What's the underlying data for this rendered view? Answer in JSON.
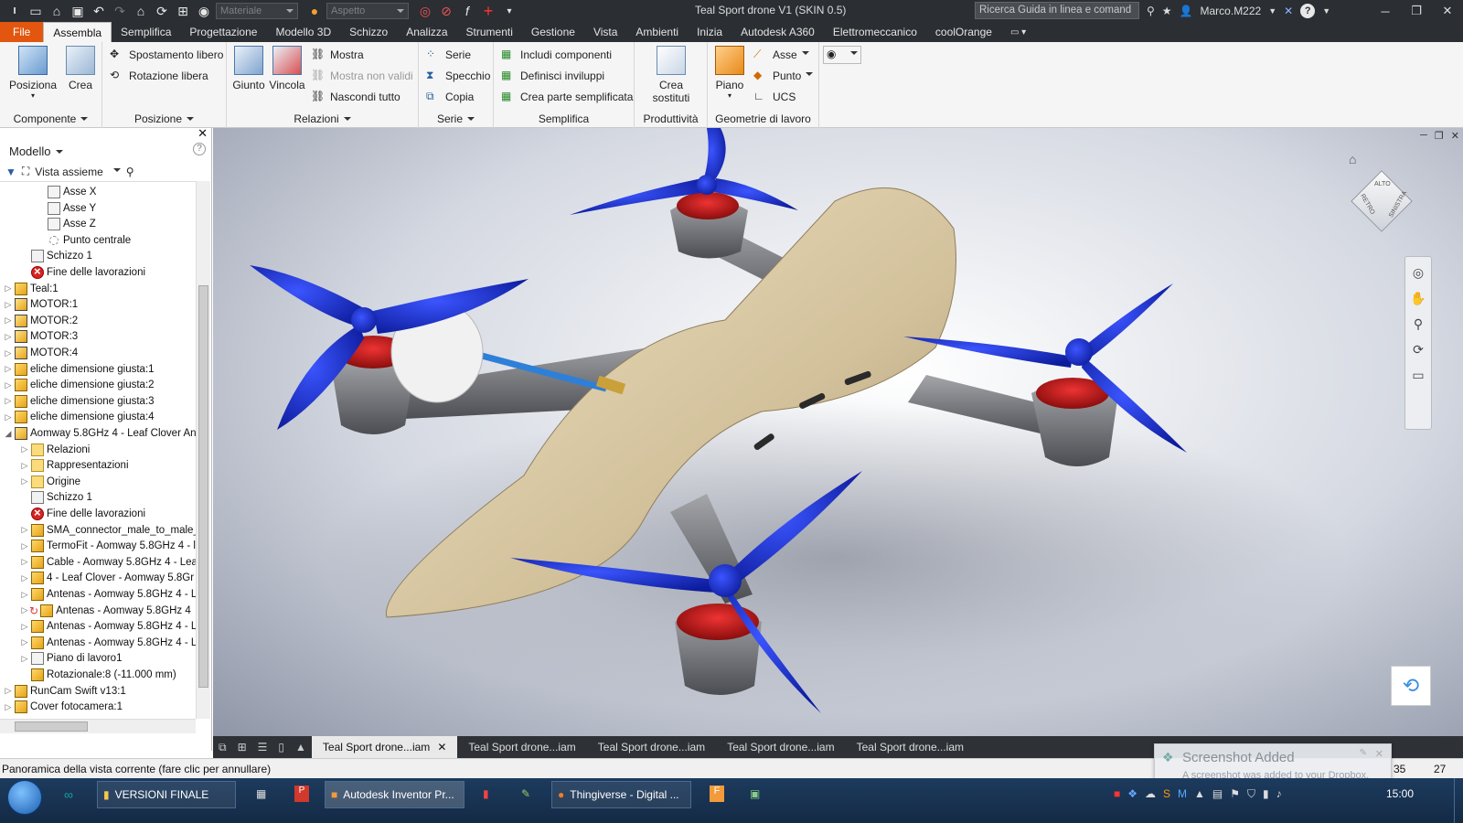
{
  "window": {
    "title": "Teal Sport drone V1 (SKIN 0.5)",
    "search_placeholder": "Ricerca Guida in linea e comand",
    "user": "Marco.M222"
  },
  "quick_access": {
    "material": "Materiale",
    "appearance": "Aspetto"
  },
  "ribbon_tabs": [
    "File",
    "Assembla",
    "Semplifica",
    "Progettazione",
    "Modello 3D",
    "Schizzo",
    "Analizza",
    "Strumenti",
    "Gestione",
    "Vista",
    "Ambienti",
    "Inizia",
    "Autodesk A360",
    "Elettromeccanico",
    "coolOrange"
  ],
  "ribbon": {
    "componente": {
      "label": "Componente",
      "posiziona": "Posiziona",
      "crea": "Crea"
    },
    "posizione": {
      "label": "Posizione",
      "spostamento": "Spostamento libero",
      "rotazione": "Rotazione libera"
    },
    "relazioni": {
      "label": "Relazioni",
      "giunto": "Giunto",
      "vincola": "Vincola",
      "mostra": "Mostra",
      "mostra_non_validi": "Mostra non validi",
      "nascondi_tutto": "Nascondi tutto"
    },
    "serie": {
      "label": "Serie",
      "serie": "Serie",
      "specchio": "Specchio",
      "copia": "Copia"
    },
    "semplifica": {
      "label": "Semplifica",
      "includi": "Includi componenti",
      "definisci": "Definisci inviluppi",
      "crea_parte": "Crea parte semplificata"
    },
    "produttivita": {
      "label": "Produttività",
      "crea_sostituti_1": "Crea",
      "crea_sostituti_2": "sostituti"
    },
    "geometrie": {
      "label": "Geometrie di lavoro",
      "piano": "Piano",
      "asse": "Asse",
      "punto": "Punto",
      "ucs": "UCS"
    }
  },
  "browser": {
    "title": "Modello",
    "view": "Vista assieme",
    "nodes": [
      {
        "label": "Asse X",
        "icon": "plane"
      },
      {
        "label": "Asse Y",
        "icon": "plane"
      },
      {
        "label": "Asse Z",
        "icon": "plane"
      },
      {
        "label": "Punto centrale",
        "icon": "point"
      },
      {
        "label": "Schizzo 1",
        "icon": "sketch"
      },
      {
        "label": "Fine delle lavorazioni",
        "icon": "error"
      },
      {
        "label": "Teal:1",
        "icon": "part-edit"
      },
      {
        "label": "MOTOR:1",
        "icon": "assembly"
      },
      {
        "label": "MOTOR:2",
        "icon": "assembly"
      },
      {
        "label": "MOTOR:3",
        "icon": "assembly"
      },
      {
        "label": "MOTOR:4",
        "icon": "assembly"
      },
      {
        "label": "eliche dimensione giusta:1",
        "icon": "part"
      },
      {
        "label": "eliche dimensione giusta:2",
        "icon": "part"
      },
      {
        "label": "eliche dimensione giusta:3",
        "icon": "part"
      },
      {
        "label": "eliche dimensione giusta:4",
        "icon": "part"
      },
      {
        "label": "Aomway 5.8GHz 4 - Leaf Clover An",
        "icon": "assembly"
      },
      {
        "label": "Relazioni",
        "icon": "folder"
      },
      {
        "label": "Rappresentazioni",
        "icon": "folder"
      },
      {
        "label": "Origine",
        "icon": "folder"
      },
      {
        "label": "Schizzo 1",
        "icon": "sketch"
      },
      {
        "label": "Fine delle lavorazioni",
        "icon": "error"
      },
      {
        "label": "SMA_connector_male_to_male_",
        "icon": "part-edit"
      },
      {
        "label": "TermoFit - Aomway 5.8GHz 4 - l",
        "icon": "part"
      },
      {
        "label": "Cable - Aomway 5.8GHz 4 - Lea",
        "icon": "part"
      },
      {
        "label": "4 - Leaf Clover - Aomway 5.8Gr",
        "icon": "part"
      },
      {
        "label": "Antenas - Aomway 5.8GHz 4 - L",
        "icon": "part"
      },
      {
        "label": "Antenas - Aomway 5.8GHz 4",
        "icon": "part-pattern"
      },
      {
        "label": "Antenas - Aomway 5.8GHz 4 - L",
        "icon": "part"
      },
      {
        "label": "Antenas - Aomway 5.8GHz 4 - L",
        "icon": "part"
      },
      {
        "label": "Piano di lavoro1",
        "icon": "plane"
      },
      {
        "label": "Rotazionale:8 (-11.000 mm)",
        "icon": "constraint"
      },
      {
        "label": "RunCam Swift v13:1",
        "icon": "part-edit"
      },
      {
        "label": "Cover fotocamera:1",
        "icon": "part-edit"
      }
    ]
  },
  "doc_tabs": [
    "Teal Sport drone...iam",
    "Teal Sport drone...iam",
    "Teal Sport drone...iam",
    "Teal Sport drone...iam",
    "Teal Sport drone...iam"
  ],
  "status": {
    "text": "Panoramica della vista corrente (fare clic per annullare)",
    "n1": "35",
    "n2": "27"
  },
  "toast": {
    "title": "Screenshot Added",
    "body": "A screenshot was added to your Dropbox."
  },
  "viewcube": {
    "top": "ALTO",
    "back": "RETRO",
    "left": "SINISTRA"
  },
  "taskbar": {
    "items": [
      "VERSIONI FINALE",
      "Autodesk Inventor Pr...",
      "Thingiverse - Digital ..."
    ],
    "clock": "15:00"
  },
  "colors": {
    "file_tab": "#e2560f",
    "propeller": "#1b2fd6",
    "body": "#d8c8a2",
    "motor": "#c41d1d"
  }
}
